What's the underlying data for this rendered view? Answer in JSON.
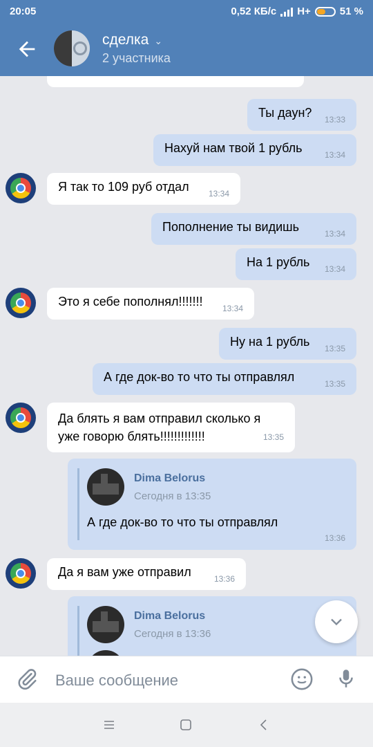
{
  "status": {
    "time": "20:05",
    "speed": "0,52 КБ/с",
    "network": "H+",
    "battery_pct": "51 %",
    "battery_level": 0.51
  },
  "header": {
    "title": "сделка",
    "subtitle": "2 участника"
  },
  "messages": [
    {
      "dir": "out",
      "text": "Ты даун?",
      "time": "13:33"
    },
    {
      "dir": "out",
      "text": "Нахуй нам твой 1 рубль",
      "time": "13:34"
    },
    {
      "dir": "in",
      "text": "Я так то 109 руб отдал",
      "time": "13:34"
    },
    {
      "dir": "out",
      "text": "Пополнение ты видишь",
      "time": "13:34"
    },
    {
      "dir": "out",
      "text": "На 1 рубль",
      "time": "13:34"
    },
    {
      "dir": "in",
      "text": "Это я себе пополнял!!!!!!!",
      "time": "13:34"
    },
    {
      "dir": "out",
      "text": "Ну на 1 рубль",
      "time": "13:35"
    },
    {
      "dir": "out",
      "text": "А где док-во то что ты отправлял",
      "time": "13:35"
    },
    {
      "dir": "in",
      "text": "Да блять я вам отправил сколько я",
      "text2": "уже говорю блять!!!!!!!!!!!!!",
      "time": "13:35"
    }
  ],
  "forwarded1": {
    "name": "Dima Belorus",
    "when": "Сегодня в 13:35",
    "text": "А где док-во то что ты отправлял",
    "time": "13:36"
  },
  "msg_last_in": {
    "text": "Да я вам уже отправил",
    "time": "13:36"
  },
  "forwarded2": {
    "name": "Dima Belorus",
    "when": "Сегодня в 13:36"
  },
  "composer": {
    "placeholder": "Ваше сообщение"
  }
}
